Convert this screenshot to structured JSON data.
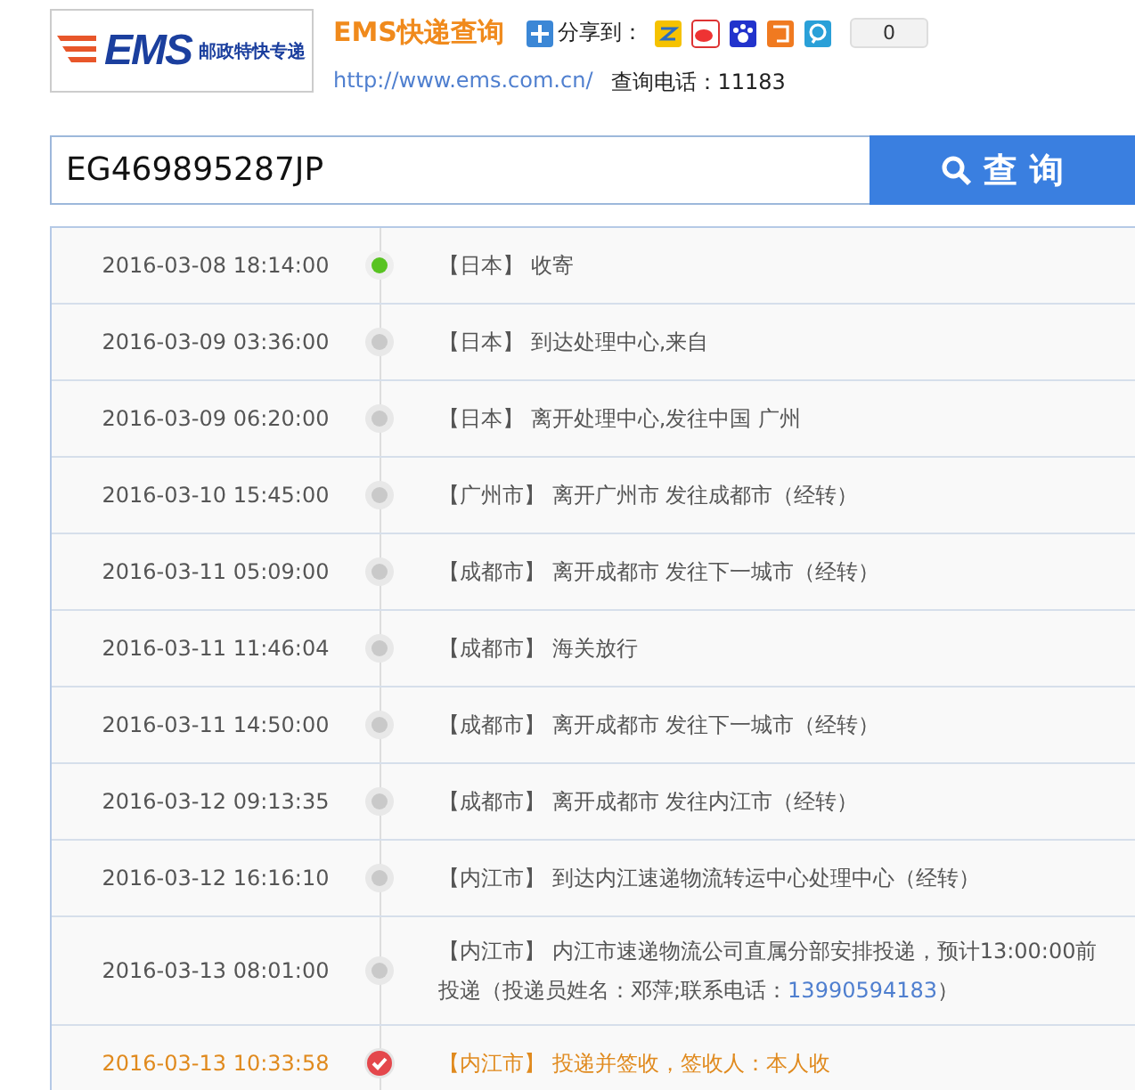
{
  "header": {
    "logo_text": "EMS",
    "logo_subtitle": "邮政特快专递",
    "title": "EMS快递查询",
    "share_label": "分享到：",
    "share_count": "0",
    "url": "http://www.ems.com.cn/",
    "hotline": "查询电话：11183"
  },
  "search": {
    "value": "EG469895287JP",
    "button": "查 询"
  },
  "tracking": [
    {
      "time": "2016-03-08 18:14:00",
      "location": "【日本】",
      "text": "收寄",
      "kind": "start"
    },
    {
      "time": "2016-03-09 03:36:00",
      "location": "【日本】",
      "text": "到达处理中心,来自",
      "kind": "normal"
    },
    {
      "time": "2016-03-09 06:20:00",
      "location": "【日本】",
      "text": "离开处理中心,发往中国 广州",
      "kind": "normal"
    },
    {
      "time": "2016-03-10 15:45:00",
      "location": "【广州市】",
      "text": "离开广州市 发往成都市（经转）",
      "kind": "normal"
    },
    {
      "time": "2016-03-11 05:09:00",
      "location": "【成都市】",
      "text": "离开成都市 发往下一城市（经转）",
      "kind": "normal"
    },
    {
      "time": "2016-03-11 11:46:04",
      "location": "【成都市】",
      "text": "海关放行",
      "kind": "normal"
    },
    {
      "time": "2016-03-11 14:50:00",
      "location": "【成都市】",
      "text": "离开成都市 发往下一城市（经转）",
      "kind": "normal"
    },
    {
      "time": "2016-03-12 09:13:35",
      "location": "【成都市】",
      "text": "离开成都市 发往内江市（经转）",
      "kind": "normal"
    },
    {
      "time": "2016-03-12 16:16:10",
      "location": "【内江市】",
      "text": "到达内江速递物流转运中心处理中心（经转）",
      "kind": "normal"
    },
    {
      "time": "2016-03-13 08:01:00",
      "location": "【内江市】",
      "text": "内江市速递物流公司直属分部安排投递，预计13:00:00前投递（投递员姓名：邓萍;联系电话：",
      "phone": "13990594183",
      "text_end": "）",
      "kind": "normal"
    },
    {
      "time": "2016-03-13 10:33:58",
      "location": "【内江市】",
      "text": "投递并签收，签收人：本人收",
      "kind": "delivered"
    }
  ]
}
